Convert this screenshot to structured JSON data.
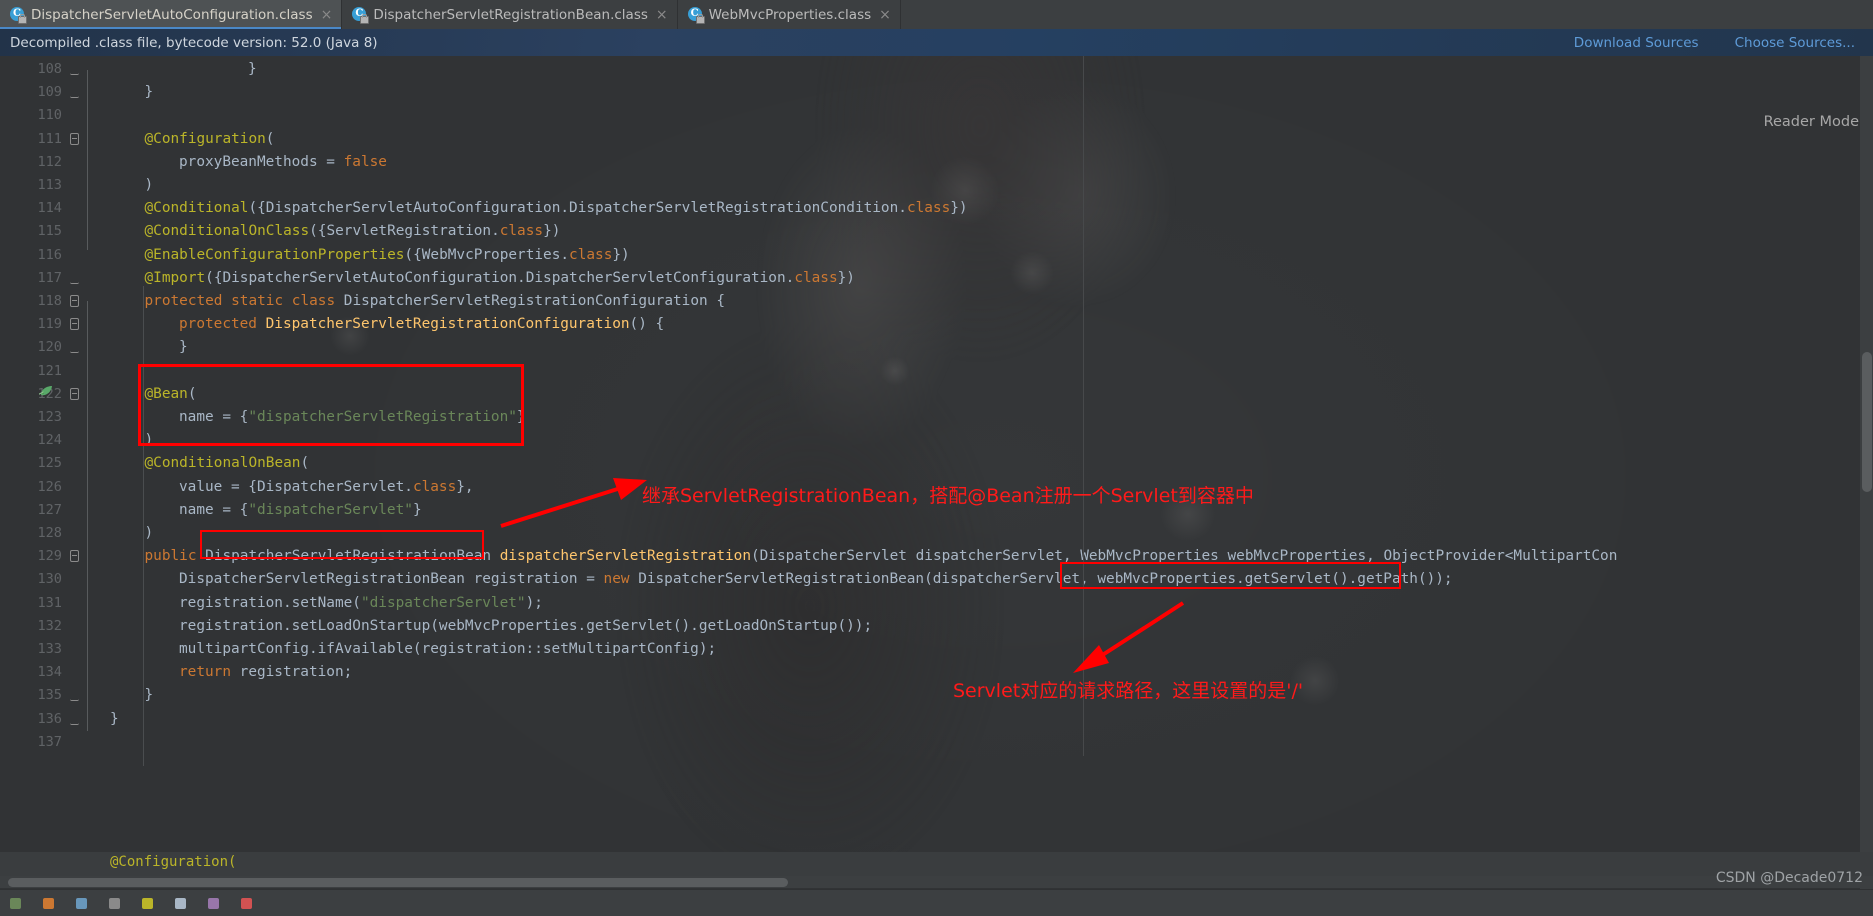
{
  "tabs": [
    {
      "label": "DispatcherServletAutoConfiguration.class",
      "icon": "java-class-icon",
      "close": "×",
      "active": true
    },
    {
      "label": "DispatcherServletRegistrationBean.class",
      "icon": "java-class-icon",
      "close": "×",
      "active": false
    },
    {
      "label": "WebMvcProperties.class",
      "icon": "java-class-icon",
      "close": "×",
      "active": false
    }
  ],
  "banner": {
    "message": "Decompiled .class file, bytecode version: 52.0 (Java 8)",
    "download_sources": "Download Sources",
    "choose_sources": "Choose Sources..."
  },
  "reader_mode": "Reader Mode",
  "watermark": "CSDN @Decade0712",
  "colors": {
    "annotation_red": "#ff0000",
    "keyword": "#cc7832",
    "annotation_syntax": "#bbb529",
    "string": "#6a8759",
    "type": "#ffc66d",
    "text": "#a9b7c6",
    "link": "#5e9bd8",
    "tab_underline": "#4a88c7"
  },
  "code": {
    "first_line_number": 108,
    "lines": [
      {
        "num": "108",
        "fold": "end",
        "indent": 4,
        "html": "}"
      },
      {
        "num": "109",
        "fold": "end",
        "indent": 1,
        "html": "}"
      },
      {
        "num": "110",
        "fold": "",
        "indent": 0,
        "html": ""
      },
      {
        "num": "111",
        "fold": "start",
        "indent": 1,
        "html": "<span class=\"ann\">@Configuration</span><span class=\"pln\">(</span>"
      },
      {
        "num": "112",
        "fold": "",
        "indent": 2,
        "html": "<span class=\"pln\">proxyBeanMethods = </span><span class=\"kw\">false</span>"
      },
      {
        "num": "113",
        "fold": "",
        "indent": 1,
        "html": "<span class=\"pln\">)</span>"
      },
      {
        "num": "114",
        "fold": "",
        "indent": 1,
        "html": "<span class=\"ann\">@Conditional</span><span class=\"pln\">({DispatcherServletAutoConfiguration.DispatcherServletRegistrationCondition.</span><span class=\"kw\">class</span><span class=\"pln\">})</span>"
      },
      {
        "num": "115",
        "fold": "",
        "indent": 1,
        "html": "<span class=\"ann\">@ConditionalOnClass</span><span class=\"pln\">({ServletRegistration.</span><span class=\"kw\">class</span><span class=\"pln\">})</span>"
      },
      {
        "num": "116",
        "fold": "",
        "indent": 1,
        "html": "<span class=\"ann\">@EnableConfigurationProperties</span><span class=\"pln\">({WebMvcProperties.</span><span class=\"kw\">class</span><span class=\"pln\">})</span>"
      },
      {
        "num": "117",
        "fold": "end",
        "indent": 1,
        "html": "<span class=\"ann\">@Import</span><span class=\"pln\">({DispatcherServletAutoConfiguration.DispatcherServletConfiguration.</span><span class=\"kw\">class</span><span class=\"pln\">})</span>"
      },
      {
        "num": "118",
        "fold": "start",
        "indent": 1,
        "html": "<span class=\"kw\">protected static class </span><span class=\"pln\">DispatcherServletRegistrationConfiguration {</span>"
      },
      {
        "num": "119",
        "fold": "start",
        "indent": 2,
        "html": "<span class=\"kw\">protected </span><span class=\"typ\">DispatcherServletRegistrationConfiguration</span><span class=\"pln\">() {</span>"
      },
      {
        "num": "120",
        "fold": "end",
        "indent": 2,
        "html": "<span class=\"pln\">}</span>"
      },
      {
        "num": "121",
        "fold": "",
        "indent": 0,
        "html": ""
      },
      {
        "num": "122",
        "fold": "start",
        "indent": 1,
        "html": "<span class=\"ann\">@Bean</span><span class=\"pln\">(</span>",
        "bean_gutter": true
      },
      {
        "num": "123",
        "fold": "",
        "indent": 2,
        "html": "<span class=\"pln\">name = {</span><span class=\"str\">\"dispatcherServletRegistration\"</span><span class=\"pln\">}</span>"
      },
      {
        "num": "124",
        "fold": "",
        "indent": 1,
        "html": "<span class=\"pln\">)</span>"
      },
      {
        "num": "125",
        "fold": "",
        "indent": 1,
        "html": "<span class=\"ann\">@ConditionalOnBean</span><span class=\"pln\">(</span>"
      },
      {
        "num": "126",
        "fold": "",
        "indent": 2,
        "html": "<span class=\"pln\">value = {DispatcherServlet.</span><span class=\"kw\">class</span><span class=\"pln\">},</span>"
      },
      {
        "num": "127",
        "fold": "",
        "indent": 2,
        "html": "<span class=\"pln\">name = {</span><span class=\"str\">\"dispatcherServlet\"</span><span class=\"pln\">}</span>",
        "bulb": true
      },
      {
        "num": "128",
        "fold": "",
        "indent": 1,
        "html": "<span class=\"pln\">)</span>"
      },
      {
        "num": "129",
        "fold": "start",
        "indent": 1,
        "html": "<span class=\"kw\">public </span><span class=\"pln\">DispatcherServletRegistrationBean </span><span class=\"typ\">dispatcherServletRegistration</span><span class=\"pln\">(DispatcherServlet dispatcherServlet, WebMvcProperties webMvcProperties, ObjectProvider&lt;MultipartCon</span>"
      },
      {
        "num": "130",
        "fold": "",
        "indent": 2,
        "html": "<span class=\"pln\">DispatcherServletRegistrationBean registration = </span><span class=\"kw\">new </span><span class=\"pln\">DispatcherServletRegistrationBean(dispatcherServlet, webMvcProperties.getServlet().getPath());</span>"
      },
      {
        "num": "131",
        "fold": "",
        "indent": 2,
        "html": "<span class=\"pln\">registration.setName(</span><span class=\"str\">\"dispatcherServlet\"</span><span class=\"pln\">);</span>"
      },
      {
        "num": "132",
        "fold": "",
        "indent": 2,
        "html": "<span class=\"pln\">registration.setLoadOnStartup(webMvcProperties.getServlet().getLoadOnStartup());</span>"
      },
      {
        "num": "133",
        "fold": "",
        "indent": 2,
        "html": "<span class=\"pln\">multipartConfig.ifAvailable(registration::setMultipartConfig);</span>"
      },
      {
        "num": "134",
        "fold": "",
        "indent": 2,
        "html": "<span class=\"kw\">return </span><span class=\"pln\">registration;</span>"
      },
      {
        "num": "135",
        "fold": "end",
        "indent": 1,
        "html": "<span class=\"pln\">}</span>"
      },
      {
        "num": "136",
        "fold": "end",
        "indent": 0,
        "html": "<span class=\"pln\">}</span>"
      },
      {
        "num": "137",
        "fold": "",
        "indent": 0,
        "html": ""
      }
    ],
    "next_block_preview": "@Configuration("
  },
  "annotations": [
    {
      "id": "bean-box",
      "label": "red-box-around-bean-annotation"
    },
    {
      "id": "return-type-box",
      "label": "red-box-around-return-type"
    },
    {
      "id": "getpath-box",
      "label": "red-box-around-getpath-call"
    },
    {
      "text_1": "继承ServletRegistrationBean，搭配@Bean注册一个Servlet到容器中"
    },
    {
      "text_2": "Servlet对应的请求路径，这里设置的是'/'"
    }
  ],
  "annotation_texts": {
    "inherit_note": "继承ServletRegistrationBean，搭配@Bean注册一个Servlet到容器中",
    "path_note": "Servlet对应的请求路径，这里设置的是'/'"
  }
}
